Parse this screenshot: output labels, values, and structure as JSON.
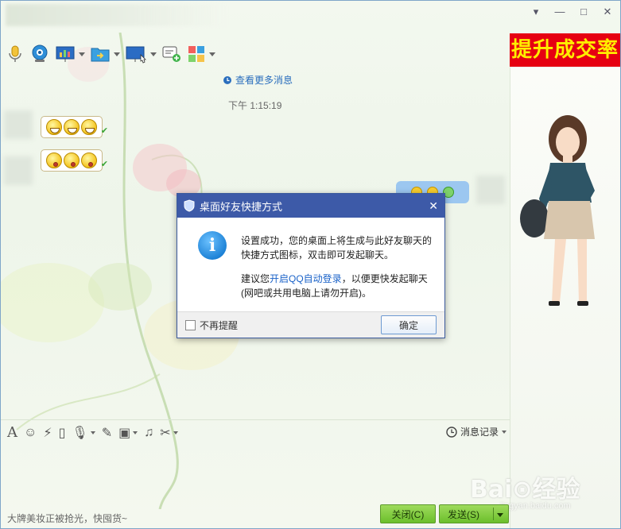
{
  "window": {
    "controls": [
      "▾",
      "—",
      "□",
      "✕"
    ]
  },
  "ad_banner": {
    "text": "提升成交率"
  },
  "chat": {
    "more_messages": "查看更多消息",
    "timestamp": "下午 1:15:19"
  },
  "dialog": {
    "title": "桌面好友快捷方式",
    "close": "✕",
    "message1": "设置成功，您的桌面上将生成与此好友聊天的快捷方式图标，双击即可发起聊天。",
    "message2_prefix": "建议您",
    "message2_link": "开启QQ自动登录",
    "message2_suffix": "，以便更快发起聊天(网吧或共用电脑上请勿开启)。",
    "checkbox_label": "不再提醒",
    "ok_button": "确定"
  },
  "input_toolbar": {
    "history_label": "消息记录"
  },
  "input": {
    "text": "大牌美妆正被抢光，快囤货~"
  },
  "buttons": {
    "close": "关闭(C)",
    "send": "发送(S)"
  },
  "watermark": {
    "main": "Bai⊙经验",
    "sub": "jingyan.baidu.com"
  },
  "colors": {
    "dialog_title_bg": "#3d5aa8",
    "ad_bg": "#e60012",
    "ad_text": "#ffee00",
    "send_button": "#6cbf2c",
    "link": "#1a62c8"
  }
}
